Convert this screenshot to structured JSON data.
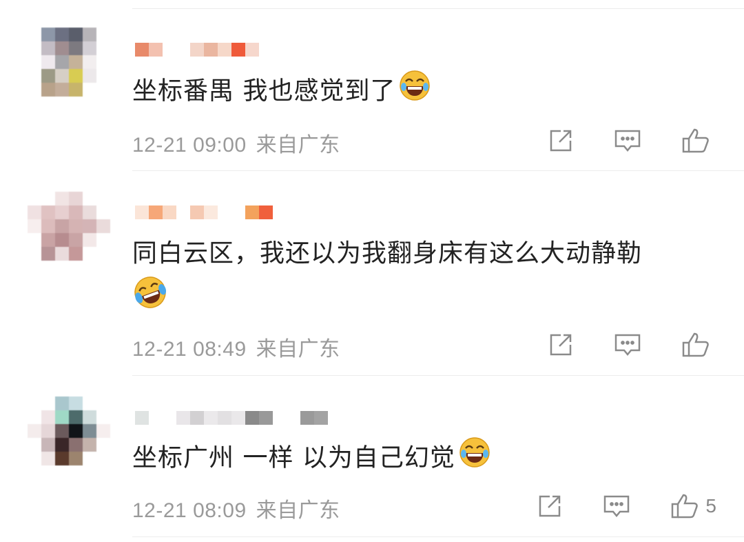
{
  "comments": [
    {
      "text": "坐标番禺 我也感觉到了",
      "emoji": "laughing-tears-emoji",
      "time": "12-21 09:00",
      "location": "来自广东",
      "likes": ""
    },
    {
      "text": "同白云区，我还以为我翻身床有这么大动静勒",
      "emoji": "crying-laughing-emoji",
      "time": "12-21 08:49",
      "location": "来自广东",
      "likes": ""
    },
    {
      "text": "坐标广州 一样 以为自己幻觉",
      "emoji": "laughing-tears-emoji",
      "time": "12-21 08:09",
      "location": "来自广东",
      "likes": "5"
    }
  ],
  "icons": {
    "share": "share-icon",
    "reply": "comment-icon",
    "like": "thumbs-up-icon"
  },
  "colors": {
    "text": "#222222",
    "meta": "#9a9a9a",
    "icon": "#8a8a8a",
    "emoji_face": "#f6c13b"
  }
}
